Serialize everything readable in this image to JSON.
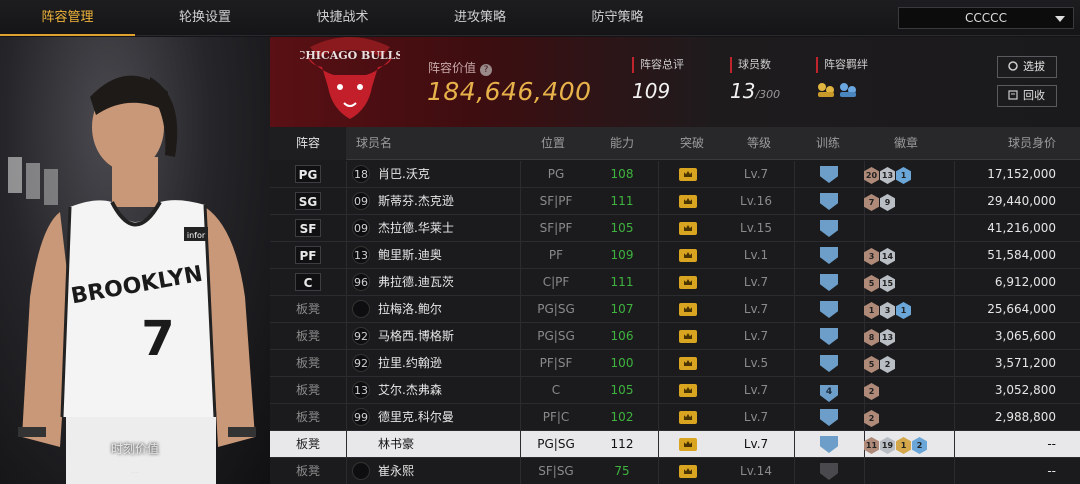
{
  "nav": {
    "tabs": [
      {
        "label": "阵容管理",
        "active": true
      },
      {
        "label": "轮换设置"
      },
      {
        "label": "快捷战术"
      },
      {
        "label": "进攻策略"
      },
      {
        "label": "防守策略"
      }
    ],
    "team_select": "CCCCC"
  },
  "left": {
    "caption": "时刻价值",
    "caption_value": "--",
    "jersey_text": "BROOKLYN",
    "jersey_number": "7",
    "jersey_tag": "infor",
    "logo_text": "CHICAGO BULLS"
  },
  "header": {
    "value_label": "阵容价值",
    "value": "184,646,400",
    "rating_label": "阵容总评",
    "rating": "109",
    "count_label": "球员数",
    "count": "13",
    "count_max": "/300",
    "bond_label": "阵容羁绊",
    "btn_select": "选拔",
    "btn_recycle": "回收"
  },
  "table": {
    "headers": [
      "阵容",
      "球员名",
      "位置",
      "能力",
      "突破",
      "等级",
      "训练",
      "徽章",
      "球员身价"
    ],
    "rows": [
      {
        "pos": "PG",
        "num": "18",
        "name": "肖巴.沃克",
        "position": "PG",
        "ability": "108",
        "level": "Lv.7",
        "train": "",
        "badges": [
          [
            "b",
            "20"
          ],
          [
            "s",
            "13"
          ],
          [
            "d",
            "1"
          ]
        ],
        "value": "17,152,000"
      },
      {
        "pos": "SG",
        "num": "09",
        "name": "斯蒂芬.杰克逊",
        "position": "SF|PF",
        "ability": "111",
        "level": "Lv.16",
        "train": "",
        "badges": [
          [
            "b",
            "7"
          ],
          [
            "s",
            "9"
          ]
        ],
        "value": "29,440,000"
      },
      {
        "pos": "SF",
        "num": "09",
        "name": "杰拉德.华莱士",
        "position": "SF|PF",
        "ability": "105",
        "level": "Lv.15",
        "train": "",
        "badges": [],
        "value": "41,216,000"
      },
      {
        "pos": "PF",
        "num": "13",
        "name": "鲍里斯.迪奥",
        "position": "PF",
        "ability": "109",
        "level": "Lv.1",
        "train": "",
        "badges": [
          [
            "b",
            "3"
          ],
          [
            "s",
            "14"
          ]
        ],
        "value": "51,584,000"
      },
      {
        "pos": "C",
        "num": "96",
        "name": "弗拉德.迪瓦茨",
        "position": "C|PF",
        "ability": "111",
        "level": "Lv.7",
        "train": "",
        "badges": [
          [
            "b",
            "5"
          ],
          [
            "s",
            "15"
          ]
        ],
        "value": "6,912,000"
      },
      {
        "pos": "板凳",
        "num": "",
        "name": "拉梅洛.鲍尔",
        "position": "PG|SG",
        "ability": "107",
        "level": "Lv.7",
        "train": "",
        "badges": [
          [
            "b",
            "1"
          ],
          [
            "s",
            "3"
          ],
          [
            "d",
            "1"
          ]
        ],
        "value": "25,664,000"
      },
      {
        "pos": "板凳",
        "num": "92",
        "name": "马格西.博格斯",
        "position": "PG|SG",
        "ability": "106",
        "level": "Lv.7",
        "train": "",
        "badges": [
          [
            "b",
            "8"
          ],
          [
            "s",
            "13"
          ]
        ],
        "value": "3,065,600"
      },
      {
        "pos": "板凳",
        "num": "92",
        "name": "拉里.约翰逊",
        "position": "PF|SF",
        "ability": "100",
        "level": "Lv.5",
        "train": "",
        "badges": [
          [
            "b",
            "5"
          ],
          [
            "s",
            "2"
          ]
        ],
        "value": "3,571,200"
      },
      {
        "pos": "板凳",
        "num": "13",
        "name": "艾尔.杰弗森",
        "position": "C",
        "ability": "105",
        "level": "Lv.7",
        "train": "4",
        "badges": [
          [
            "b",
            "2"
          ]
        ],
        "value": "3,052,800"
      },
      {
        "pos": "板凳",
        "num": "99",
        "name": "德里克.科尔曼",
        "position": "PF|C",
        "ability": "102",
        "level": "Lv.7",
        "train": "",
        "badges": [
          [
            "b",
            "2"
          ]
        ],
        "value": "2,988,800"
      },
      {
        "pos": "板凳",
        "num": "",
        "name": "林书豪",
        "position": "PG|SG",
        "ability": "112",
        "level": "Lv.7",
        "train": "",
        "badges": [
          [
            "b",
            "11"
          ],
          [
            "s",
            "19"
          ],
          [
            "g",
            "1"
          ],
          [
            "d",
            "2"
          ]
        ],
        "value": "--",
        "selected": true
      },
      {
        "pos": "板凳",
        "num": "",
        "name": "崔永熙",
        "position": "SF|SG",
        "ability": "75",
        "level": "Lv.14",
        "train": "",
        "badges": [],
        "value": "--",
        "grey": true
      }
    ]
  }
}
